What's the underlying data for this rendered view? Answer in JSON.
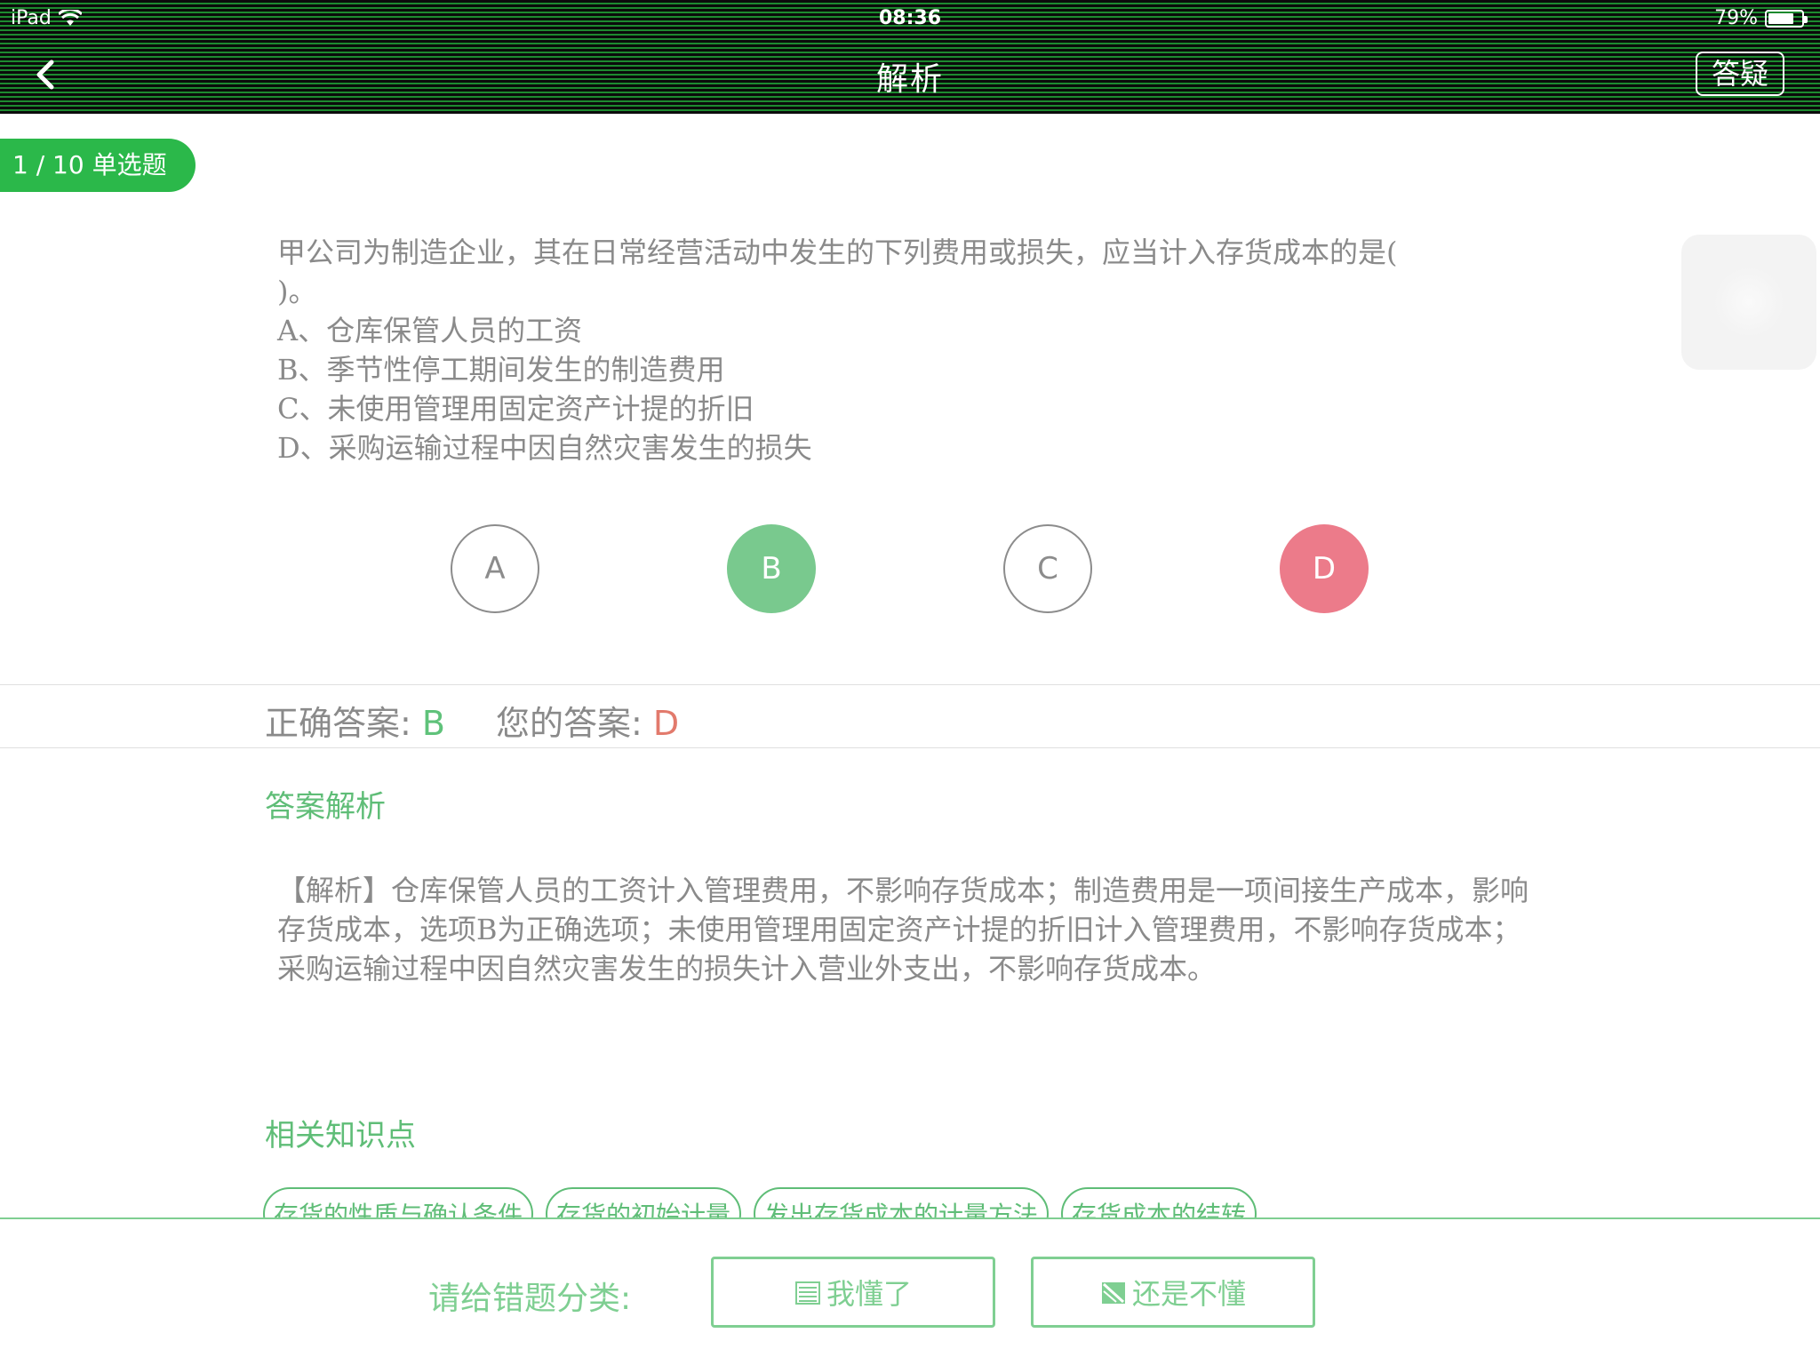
{
  "status_bar": {
    "device": "iPad",
    "time": "08:36",
    "battery": "79%",
    "battery_level": 0.79
  },
  "nav": {
    "title": "解析",
    "qa_label": "答疑"
  },
  "question": {
    "tag": "1 / 10  单选题",
    "stem": "甲公司为制造企业，其在日常经营活动中发生的下列费用或损失，应当计入存货成本的是(",
    "stem_end": ")。",
    "options": [
      "A、仓库保管人员的工资",
      "B、季节性停工期间发生的制造费用",
      "C、未使用管理用固定资产计提的折旧",
      "D、采购运输过程中因自然灾害发生的损失"
    ]
  },
  "choices": [
    "A",
    "B",
    "C",
    "D"
  ],
  "answers": {
    "correct_label": "正确答案: ",
    "correct_value": "B",
    "yours_label": "您的答案: ",
    "yours_value": "D"
  },
  "analysis": {
    "title": "答案解析",
    "text": "【解析】仓库保管人员的工资计入管理费用，不影响存货成本；制造费用是一项间接生产成本，影响存货成本，选项B为正确选项；未使用管理用固定资产计提的折旧计入管理费用，不影响存货成本；采购运输过程中因自然灾害发生的损失计入营业外支出，不影响存货成本。"
  },
  "knowledge": {
    "title": "相关知识点",
    "tags": [
      "存货的性质与确认条件",
      "存货的初始计量",
      "发出存货成本的计量方法",
      "存货成本的结转"
    ]
  },
  "bottom": {
    "label": "请给错题分类:",
    "understood": "我懂了",
    "not_understood": "还是不懂"
  },
  "colors": {
    "brand_green": "#2bb84a",
    "correct_green": "#79c98e",
    "wrong_red": "#ec7b8a",
    "text_gray": "#8a8a8a"
  },
  "icons": [
    "wifi-icon",
    "battery-icon",
    "back-chevron-icon",
    "understood-icon",
    "not-understood-icon"
  ]
}
